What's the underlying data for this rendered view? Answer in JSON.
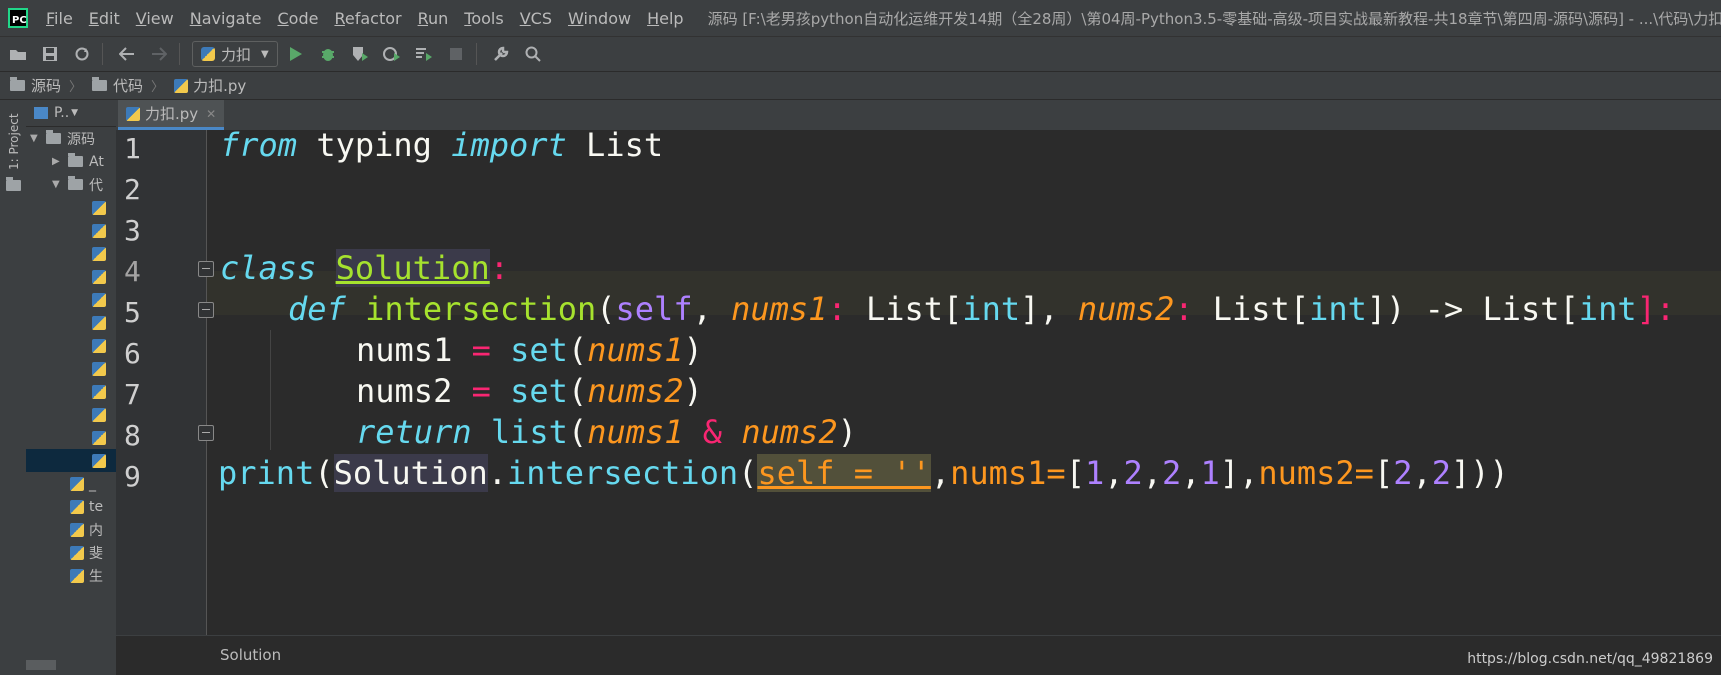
{
  "app": {
    "logo_text": "PC"
  },
  "menu": [
    "File",
    "Edit",
    "View",
    "Navigate",
    "Code",
    "Refactor",
    "Run",
    "Tools",
    "VCS",
    "Window",
    "Help"
  ],
  "window_title": "源码 [F:\\老男孩python自动化运维开发14期（全28周）\\第04周-Python3.5-零基础-高级-项目实战最新教程-共18章节\\第四周-源码\\源码] - ...\\代码\\力扣.py",
  "toolbar": {
    "run_config": "力扣"
  },
  "breadcrumbs": [
    "源码",
    "代码",
    "力扣.py"
  ],
  "left_strip": {
    "project_tab": "1: Project"
  },
  "project_panel": {
    "header": "P..",
    "rows": [
      {
        "label": "源码",
        "kind": "folder",
        "expanded": true
      },
      {
        "label": "At",
        "kind": "folder",
        "expanded": false
      },
      {
        "label": "代",
        "kind": "folder",
        "expanded": true
      },
      {
        "label": "",
        "kind": "file"
      },
      {
        "label": "",
        "kind": "file"
      },
      {
        "label": "",
        "kind": "file"
      },
      {
        "label": "",
        "kind": "file"
      },
      {
        "label": "",
        "kind": "file"
      },
      {
        "label": "",
        "kind": "file"
      },
      {
        "label": "",
        "kind": "file"
      },
      {
        "label": "",
        "kind": "file"
      },
      {
        "label": "",
        "kind": "file"
      },
      {
        "label": "",
        "kind": "file"
      },
      {
        "label": "",
        "kind": "file"
      },
      {
        "label": "",
        "kind": "file",
        "selected": true
      },
      {
        "label": "_",
        "kind": "file"
      },
      {
        "label": "te",
        "kind": "file"
      },
      {
        "label": "内",
        "kind": "file"
      },
      {
        "label": "斐",
        "kind": "file"
      },
      {
        "label": "生",
        "kind": "file"
      }
    ]
  },
  "editor_tab": {
    "label": "力扣.py"
  },
  "code": {
    "line_numbers": [
      "1",
      "2",
      "3",
      "4",
      "5",
      "6",
      "7",
      "8",
      "9"
    ],
    "line1": {
      "from": "from",
      "typing": " typing ",
      "import": "import",
      "List": " List"
    },
    "line4": {
      "class": "class",
      "name": "Solution",
      "colon": ":"
    },
    "line5": {
      "def": "def",
      "fn": "intersection",
      "p1": "(",
      "self": "self",
      "c1": ", ",
      "n1": "nums1",
      "col1": ":",
      " t1": " List[",
      "int1": "int",
      "t1b": "], ",
      "n2": "nums2",
      "col2": ":",
      "t2": " List[",
      "int2": "int",
      "t2b": "]) -> List[",
      "int3": "int",
      "end": "]:"
    },
    "line6": {
      "var": "nums1",
      "eq": " = ",
      "fn": "set",
      "p": "(",
      "arg": "nums1",
      ")": ")"
    },
    "line7": {
      "var": "nums2",
      "eq": " = ",
      "fn": "set",
      "p": "(",
      "arg": "nums2",
      ")": ")"
    },
    "line8": {
      "ret": "return",
      "fn": " list",
      "p": "(",
      "a": "nums1",
      "amp": " & ",
      "b": "nums2",
      ")": ")"
    },
    "line9": {
      "print": "print",
      "p1": "(",
      "cls": "Solution",
      "dot": ".",
      "fn": "intersection",
      "p2": "(",
      "selfarg": "self = ''",
      "comma": ",",
      "k1": "nums1=",
      "lb1": "[",
      "v1": "1",
      ",a": ",",
      "v2": "2",
      ",b": ",",
      "v3": "2",
      ",c": ",",
      "v4": "1",
      "rb1": "],",
      "k2": "nums2=",
      "lb2": "[",
      "v5": "2",
      ",d": ",",
      "v6": "2",
      "end": "]))"
    }
  },
  "status": {
    "context": "Solution",
    "watermark": "https://blog.csdn.net/qq_49821869"
  }
}
